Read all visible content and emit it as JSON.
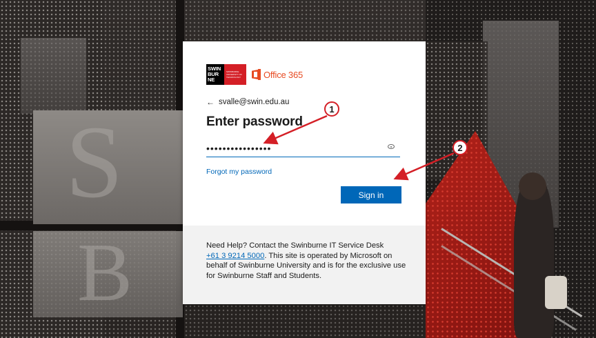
{
  "login": {
    "brand": {
      "swin_logo_text": "SWIN BUR NE",
      "swin_tagline": "SWINBURNE UNIVERSITY OF TECHNOLOGY",
      "product_name": "Office 365"
    },
    "identity": {
      "back_arrow": "←",
      "email": "svalle@swin.edu.au"
    },
    "title": "Enter password",
    "password": {
      "masked_value": "••••••••••••••••"
    },
    "forgot_label": "Forgot my password",
    "signin_label": "Sign in",
    "help": {
      "intro": "Need Help? Contact the Swinburne IT Service Desk",
      "phone": "+61 3 9214 5000",
      "rest": ". This site is operated by Microsoft on behalf of Swinburne University and is for the exclusive use for Swinburne Staff and Students."
    }
  },
  "annotations": {
    "badge_1": "1",
    "badge_2": "2",
    "color": "#d41f26"
  },
  "colors": {
    "accent": "#0067b8",
    "office_orange": "#e74a21",
    "swin_red": "#d41f26"
  }
}
